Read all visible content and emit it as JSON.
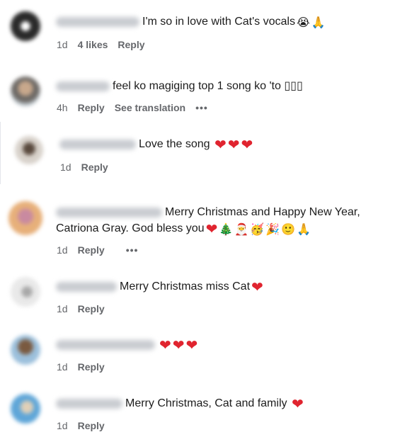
{
  "comments": [
    {
      "text": "I'm so in love with Cat's vocals",
      "emojis": [
        "😭",
        "🙏"
      ],
      "time": "1d",
      "likes": "4 likes",
      "reply": "Reply"
    },
    {
      "text": "feel ko magiging top 1 song ko 'to",
      "trail": "▯▯▯",
      "time": "4h",
      "reply": "Reply",
      "translate": "See translation",
      "more": "•••"
    },
    {
      "text": "Love the song",
      "emojis": [
        "❤",
        "❤",
        "❤"
      ],
      "time": "1d",
      "reply": "Reply"
    },
    {
      "text_line1": "Merry Christmas and Happy New Year,",
      "text_line2": "Catriona Gray. God bless you",
      "emojis": [
        "❤",
        "🎄",
        "🎅",
        "🥳",
        "🎉",
        "🙂",
        "🙏"
      ],
      "time": "1d",
      "reply": "Reply",
      "more": "•••"
    },
    {
      "text": "Merry Christmas miss Cat",
      "emojis": [
        "❤"
      ],
      "time": "1d",
      "reply": "Reply"
    },
    {
      "emojis": [
        "❤",
        "❤",
        "❤"
      ],
      "time": "1d",
      "reply": "Reply"
    },
    {
      "text": "Merry Christmas, Cat and family",
      "emojis": [
        "❤"
      ],
      "time": "1d",
      "reply": "Reply"
    }
  ],
  "colors": {
    "text": "#1c1c1c",
    "meta": "#65676b",
    "heart": "#e0242f",
    "blur": "#c9ccd1"
  }
}
